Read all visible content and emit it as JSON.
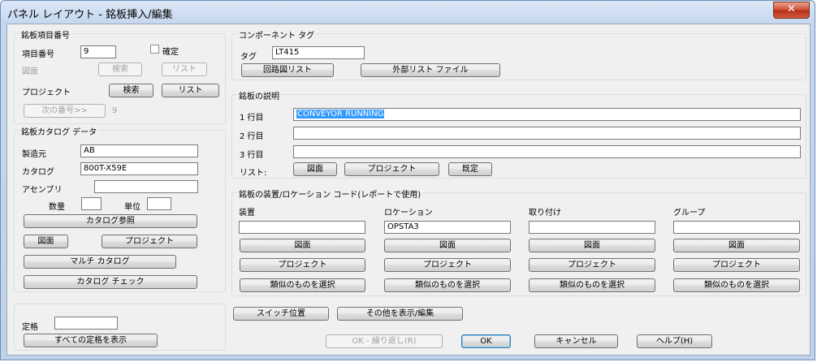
{
  "window": {
    "title": "パネル レイアウト - 銘板挿入/編集",
    "close_label": "✕"
  },
  "item_number": {
    "group_title": "銘板項目番号",
    "label": "項目番号",
    "value": "9",
    "confirm_label": "確定",
    "drawing_label": "図面",
    "search_label": "検索",
    "list_label": "リスト",
    "project_label": "プロジェクト",
    "project_search_label": "検索",
    "project_list_label": "リスト",
    "next_number_label": "次の番号>>",
    "next_number_value": "9"
  },
  "catalog": {
    "group_title": "銘板カタログ データ",
    "manufacturer_label": "製造元",
    "manufacturer_value": "AB",
    "catalog_label": "カタログ",
    "catalog_value": "800T-X59E",
    "assembly_label": "アセンブリ",
    "assembly_value": "",
    "quantity_label": "数量",
    "quantity_value": "",
    "unit_label": "単位",
    "unit_value": "",
    "catalog_lookup_label": "カタログ参照",
    "drawing_label": "図面",
    "project_label": "プロジェクト",
    "multi_catalog_label": "マルチ カタログ",
    "catalog_check_label": "カタログ チェック"
  },
  "rating": {
    "label": "定格",
    "value": "",
    "show_all_label": "すべての定格を表示"
  },
  "component_tag": {
    "group_title": "コンポーネント タグ",
    "tag_label": "タグ",
    "tag_value": "LT415",
    "schematic_list_label": "回路図リスト",
    "external_list_label": "外部リスト ファイル"
  },
  "description": {
    "group_title": "銘板の説明",
    "line1_label": "1 行目",
    "line1_value": "CONVEYOR  RUNNING",
    "line2_label": "2 行目",
    "line2_value": "",
    "line3_label": "3 行目",
    "line3_value": "",
    "list_label": "リスト:",
    "drawing_label": "図面",
    "project_label": "プロジェクト",
    "default_label": "既定"
  },
  "location": {
    "group_title": "銘板の装置/ロケーション コード(レポートで使用)",
    "columns": [
      {
        "label": "装置",
        "value": ""
      },
      {
        "label": "ロケーション",
        "value": "OPSTA3"
      },
      {
        "label": "取り付け",
        "value": ""
      },
      {
        "label": "グループ",
        "value": ""
      }
    ],
    "drawing_label": "図面",
    "project_label": "プロジェクト",
    "select_similar_label": "類似のものを選択"
  },
  "bottom": {
    "switch_position_label": "スイッチ位置",
    "show_other_label": "その他を表示/編集",
    "ok_repeat_label": "OK - 繰り返し(R)",
    "ok_label": "OK",
    "cancel_label": "キャンセル",
    "help_label": "ヘルプ(H)"
  }
}
